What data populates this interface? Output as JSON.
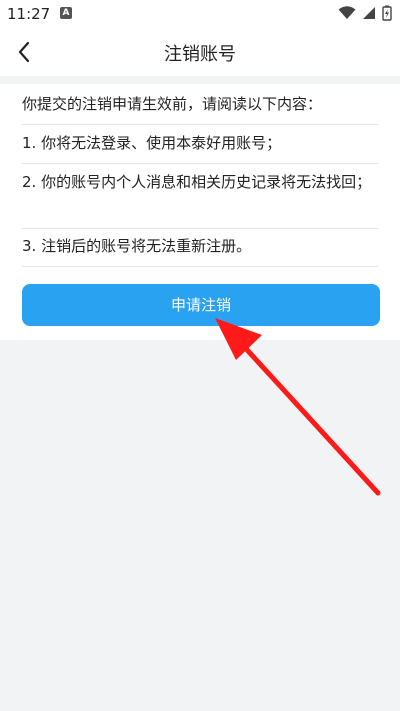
{
  "status": {
    "time": "11:27",
    "a_badge": "A"
  },
  "header": {
    "title": "注销账号"
  },
  "notice": {
    "intro": "你提交的注销申请生效前，请阅读以下内容：",
    "items": [
      "1. 你将无法登录、使用本泰好用账号；",
      "2. 你的账号内个人消息和相关历史记录将无法找回；",
      "3. 注销后的账号将无法重新注册。"
    ]
  },
  "actions": {
    "apply_label": "申请注销"
  },
  "colors": {
    "accent": "#2aa2f2",
    "arrow": "#ff1a1a"
  }
}
